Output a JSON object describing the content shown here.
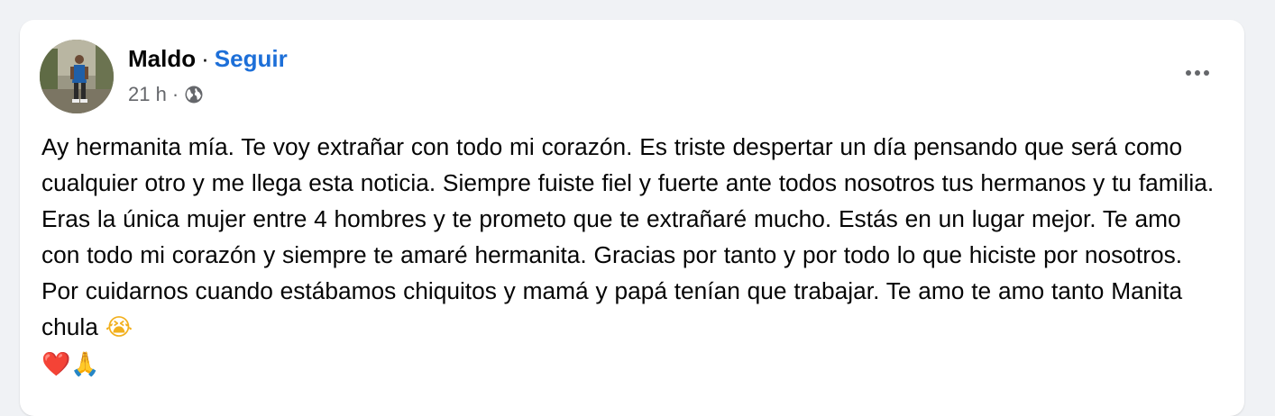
{
  "post": {
    "author": "Maldo",
    "separator": "·",
    "follow_label": "Seguir",
    "time": "21 h",
    "meta_separator": "·",
    "privacy_icon": "globe-icon",
    "more_icon": "more-options-icon",
    "body": "Ay hermanita mía. Te voy extrañar con todo mi corazón. Es triste despertar un día pensando que será como cualquier otro y me llega esta noticia. Siempre fuiste fiel y fuerte ante todos nosotros tus hermanos y tu familia. Eras la única mujer entre 4 hombres y te prometo que te extrañaré mucho. Estás en un lugar mejor. Te amo con todo mi corazón y siempre te amaré hermanita. Gracias por tanto y por todo lo que hiciste por nosotros. Por cuidarnos cuando estábamos chiquitos y mamá y papá tenían que trabajar. Te amo te amo tanto Manita chula",
    "emojis": {
      "crying": "😭",
      "heart": "❤️",
      "pray": "🙏"
    }
  },
  "colors": {
    "background": "#f0f2f5",
    "card": "#ffffff",
    "link": "#1d6fd8",
    "text": "#050505",
    "secondary_text": "#65676b"
  }
}
